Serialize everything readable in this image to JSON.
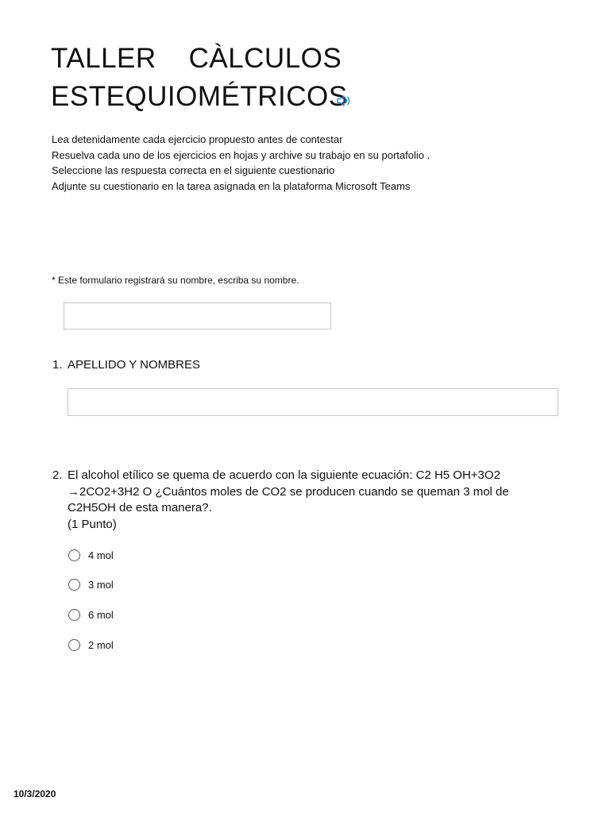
{
  "title": {
    "line1": "TALLER    CÀLCULOS",
    "line2": "ESTEQUIOMÉTRICOS"
  },
  "icons": {
    "speaker": "speaker-icon",
    "speaker_color": "#2b88d8"
  },
  "instructions": [
    "Lea detenidamente cada ejercicio propuesto antes de contestar",
    "Resuelva cada uno de los ejercicios en hojas y archive su trabajo en su portafolio .",
    "Seleccione las respuesta correcta en el siguiente  cuestionario",
    "Adjunte su cuestionario en la tarea asignada en la plataforma Microsoft Teams"
  ],
  "notice": "*  Este formulario registrará su nombre, escriba su nombre.",
  "name_field": {
    "value": ""
  },
  "questions": [
    {
      "number": "1.",
      "lines": [
        "APELLIDO Y NOMBRES"
      ],
      "answer": ""
    },
    {
      "number": "2.",
      "lines": [
        "El alcohol etílico se quema de acuerdo con la siguiente ecuación: C2 H5 OH+3O2",
        "→2CO2+3H2 O ¿Cuántos moles de CO2 se producen cuando se queman 3 mol de",
        "C2H5OH de esta manera?.",
        "(1 Punto)"
      ],
      "options": [
        "4 mol",
        "3 mol",
        "6 mol",
        "2 mol"
      ],
      "selected": null
    }
  ],
  "footer": {
    "date": "10/3/2020"
  }
}
